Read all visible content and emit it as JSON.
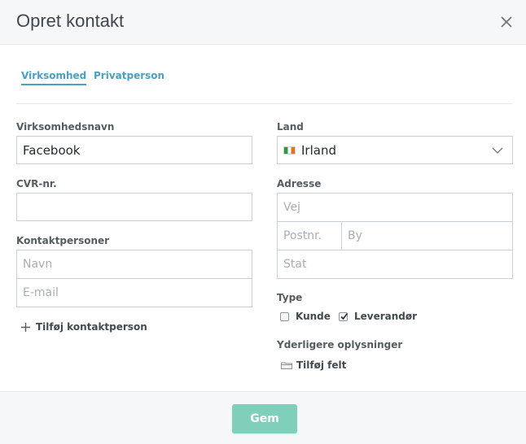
{
  "dialog": {
    "title": "Opret kontakt"
  },
  "tabs": [
    {
      "label": "Virksomhed",
      "active": true
    },
    {
      "label": "Privatperson",
      "active": false
    }
  ],
  "left": {
    "company_name": {
      "label": "Virksomhedsnavn",
      "value": "Facebook"
    },
    "cvr": {
      "label": "CVR-nr.",
      "value": ""
    },
    "contacts": {
      "label": "Kontaktpersoner",
      "name_placeholder": "Navn",
      "email_placeholder": "E-mail",
      "add_label": "Tilføj kontaktperson"
    }
  },
  "right": {
    "country": {
      "label": "Land",
      "value": "Irland",
      "flag_icon": "ireland-flag-icon"
    },
    "address": {
      "label": "Adresse",
      "street_placeholder": "Vej",
      "zip_placeholder": "Postnr.",
      "city_placeholder": "By",
      "state_placeholder": "Stat"
    },
    "type": {
      "label": "Type",
      "options": [
        {
          "label": "Kunde",
          "checked": false
        },
        {
          "label": "Leverandør",
          "checked": true
        }
      ]
    },
    "extra": {
      "label": "Yderligere oplysninger",
      "add_field_label": "Tilføj felt"
    }
  },
  "footer": {
    "save_label": "Gem"
  },
  "colors": {
    "accent": "#4a9fc4",
    "save_button": "#7fcfba",
    "border": "#c9cfd3"
  }
}
